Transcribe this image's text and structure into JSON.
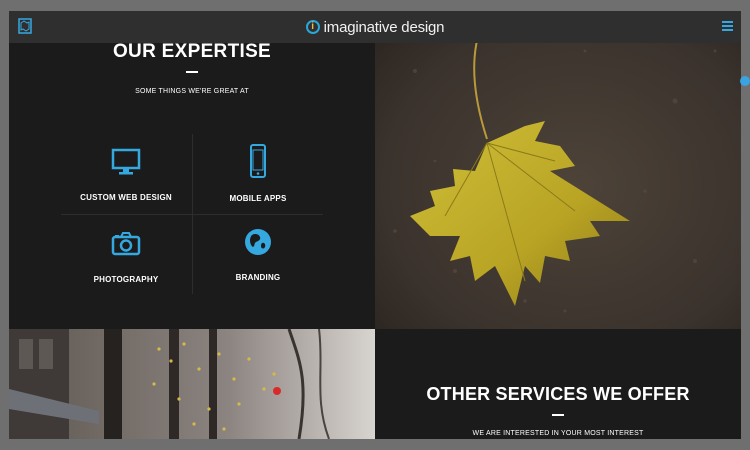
{
  "header": {
    "brand": "imaginative design",
    "logo_glyph": "i",
    "left_icon": "book-map-icon",
    "menu_icon": "hamburger-menu-icon"
  },
  "expertise": {
    "title": "OUR EXPERTISE",
    "subtitle": "SOME THINGS WE'RE GREAT AT",
    "items": [
      {
        "label": "CUSTOM WEB DESIGN",
        "icon": "monitor-icon"
      },
      {
        "label": "MOBILE APPS",
        "icon": "smartphone-icon"
      },
      {
        "label": "PHOTOGRAPHY",
        "icon": "camera-icon"
      },
      {
        "label": "BRANDING",
        "icon": "globe-icon"
      }
    ]
  },
  "other_services": {
    "title": "OTHER SERVICES WE OFFER",
    "subtitle": "WE ARE INTERESTED IN YOUR MOST INTEREST"
  },
  "colors": {
    "accent": "#35a8e0",
    "panel": "#1b1b1b",
    "topbar": "#2f2f2f",
    "frame_border": "#6f6f6f"
  }
}
